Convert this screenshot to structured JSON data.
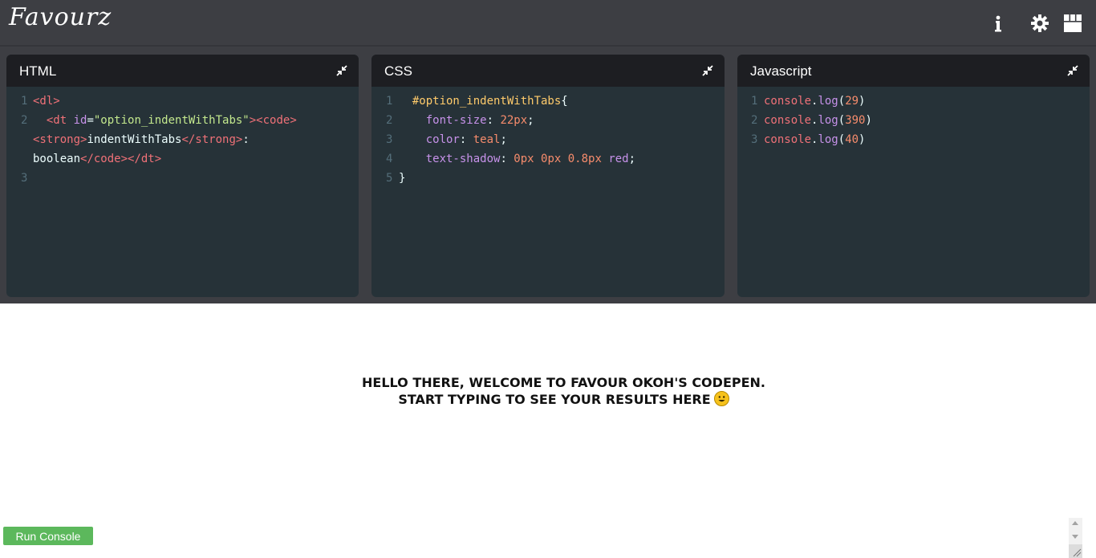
{
  "app": {
    "logo_text": "Favourz"
  },
  "toolbar": {
    "icons": [
      "info-icon",
      "settings-gear-icon",
      "layout-grid-icon"
    ]
  },
  "panels": [
    {
      "title": "HTML",
      "lines": [
        {
          "num": "1",
          "tokens": [
            [
              "tag",
              "<dl>"
            ]
          ]
        },
        {
          "num": "2",
          "tokens": [
            [
              "plain",
              "  "
            ],
            [
              "tag",
              "<dt "
            ],
            [
              "attr",
              "id"
            ],
            [
              "plain",
              "="
            ],
            [
              "str",
              "\"option_indentWithTabs\""
            ],
            [
              "tag",
              "><code>"
            ]
          ]
        },
        {
          "num": "",
          "tokens": [
            [
              "tag",
              "<strong>"
            ],
            [
              "plain",
              "indentWithTabs"
            ],
            [
              "tag",
              "</strong>"
            ],
            [
              "plain",
              ":"
            ]
          ]
        },
        {
          "num": "",
          "tokens": [
            [
              "plain",
              "boolean"
            ],
            [
              "tag",
              "</code></dt>"
            ]
          ]
        },
        {
          "num": "3",
          "tokens": []
        }
      ]
    },
    {
      "title": "CSS",
      "lines": [
        {
          "num": "1",
          "tokens": [
            [
              "plain",
              "  "
            ],
            [
              "sel",
              "#option_indentWithTabs"
            ],
            [
              "plain",
              "{"
            ]
          ]
        },
        {
          "num": "2",
          "tokens": [
            [
              "plain",
              "    "
            ],
            [
              "prop",
              "font-size"
            ],
            [
              "plain",
              ": "
            ],
            [
              "val",
              "22px"
            ],
            [
              "plain",
              ";"
            ]
          ]
        },
        {
          "num": "3",
          "tokens": [
            [
              "plain",
              "    "
            ],
            [
              "prop",
              "color"
            ],
            [
              "plain",
              ": "
            ],
            [
              "val",
              "teal"
            ],
            [
              "plain",
              ";"
            ]
          ]
        },
        {
          "num": "4",
          "tokens": [
            [
              "plain",
              "    "
            ],
            [
              "prop",
              "text-shadow"
            ],
            [
              "plain",
              ": "
            ],
            [
              "val",
              "0px 0px 0.8px"
            ],
            [
              "plain",
              " "
            ],
            [
              "kw",
              "red"
            ],
            [
              "plain",
              ";"
            ]
          ]
        },
        {
          "num": "5",
          "tokens": [
            [
              "plain",
              "}"
            ]
          ]
        }
      ]
    },
    {
      "title": "Javascript",
      "lines": [
        {
          "num": "1",
          "tokens": [
            [
              "tag",
              "console"
            ],
            [
              "plain",
              "."
            ],
            [
              "kw",
              "log"
            ],
            [
              "plain",
              "("
            ],
            [
              "num",
              "29"
            ],
            [
              "plain",
              ")"
            ]
          ]
        },
        {
          "num": "2",
          "tokens": [
            [
              "tag",
              "console"
            ],
            [
              "plain",
              "."
            ],
            [
              "kw",
              "log"
            ],
            [
              "plain",
              "("
            ],
            [
              "num",
              "390"
            ],
            [
              "plain",
              ")"
            ]
          ]
        },
        {
          "num": "3",
          "tokens": [
            [
              "tag",
              "console"
            ],
            [
              "plain",
              "."
            ],
            [
              "kw",
              "log"
            ],
            [
              "plain",
              "("
            ],
            [
              "num",
              "40"
            ],
            [
              "plain",
              ")"
            ]
          ]
        }
      ]
    }
  ],
  "preview": {
    "line1": "HELLO THERE, WELCOME TO FAVOUR OKOH'S CODEPEN.",
    "line2": "START TYPING TO SEE YOUR RESULTS HERE"
  },
  "console": {
    "run_label": "Run Console"
  },
  "colors": {
    "topbar": "#3d3e43",
    "panel_bg": "#263238",
    "panel_head": "#1d1e22",
    "run_button": "#5cb85c"
  }
}
